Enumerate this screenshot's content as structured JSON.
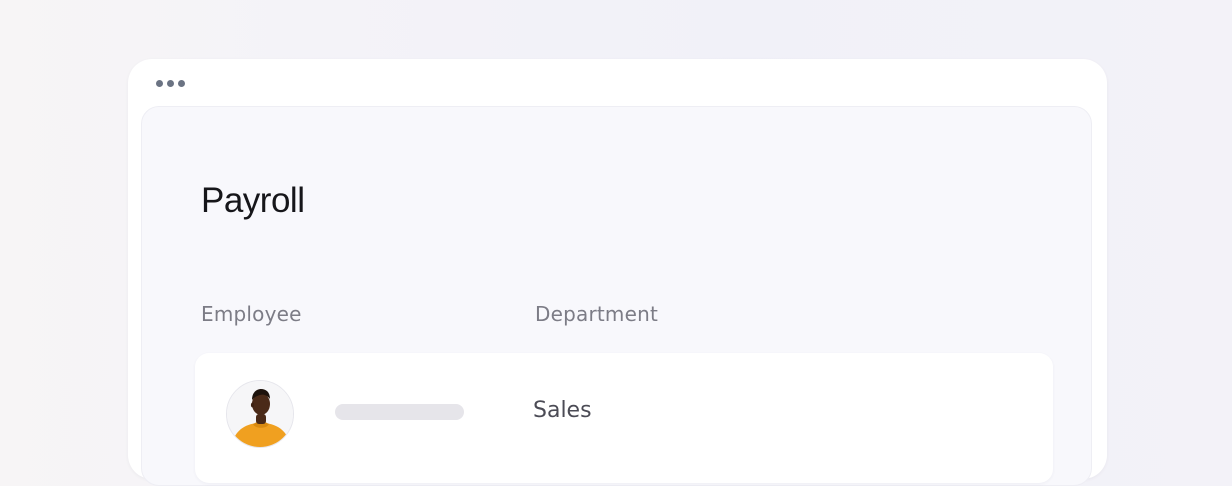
{
  "window": {
    "dots": [
      "dot",
      "dot",
      "dot"
    ]
  },
  "page": {
    "title": "Payroll"
  },
  "table": {
    "columns": [
      "Employee",
      "Department"
    ],
    "rows": [
      {
        "employee_avatar": "person-avatar-icon",
        "employee_name": "",
        "department": "Sales"
      }
    ]
  },
  "colors": {
    "background": "#f3f2f8",
    "card": "#ffffff",
    "panel": "#f8f8fc",
    "avatar_shirt": "#f0a020",
    "dots": "#6b7383"
  }
}
